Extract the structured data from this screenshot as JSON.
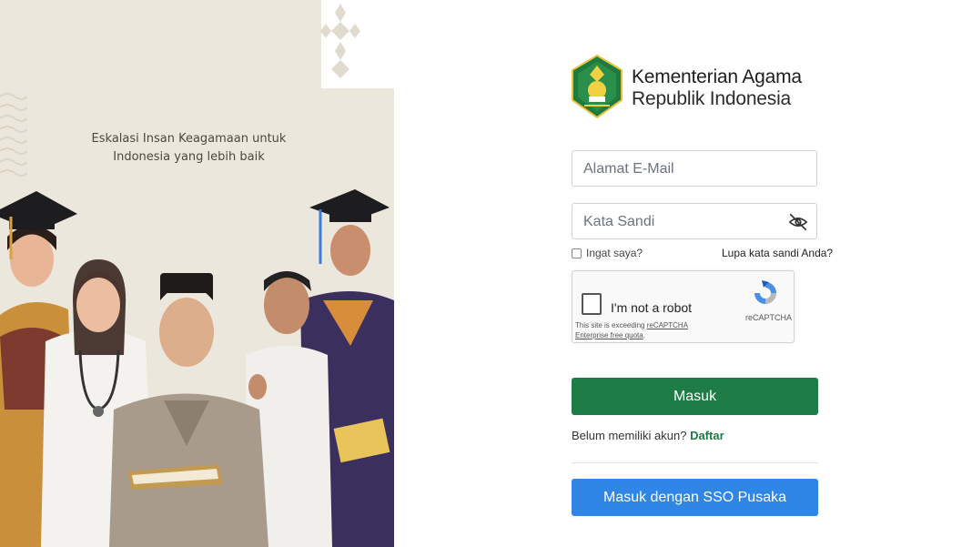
{
  "hero": {
    "tagline_line1": "Eskalasi Insan Keagamaan untuk",
    "tagline_line2": "Indonesia yang lebih baik",
    "background_color": "#ece7dc"
  },
  "brand": {
    "title": "Kementerian Agama",
    "subtitle": "Republik Indonesia",
    "logo_icon": "kemenag-emblem-icon"
  },
  "form": {
    "email_placeholder": "Alamat E-Mail",
    "email_value": "",
    "password_placeholder": "Kata Sandi",
    "password_value": "",
    "password_toggle_icon": "eye-off-icon",
    "remember_label": "Ingat saya?",
    "remember_checked": false,
    "forgot_label": "Lupa kata sandi Anda?"
  },
  "captcha": {
    "label": "I'm not a robot",
    "note_prefix": "This site is exceeding ",
    "note_link": "reCAPTCHA Enterprise free quota",
    "note_suffix": ".",
    "brand": "reCAPTCHA"
  },
  "actions": {
    "login_label": "Masuk",
    "register_prompt": "Belum memiliki akun?",
    "register_link": "Daftar",
    "sso_label": "Masuk dengan SSO Pusaka"
  },
  "colors": {
    "primary_green": "#1e7c46",
    "sso_blue": "#2f86e6"
  }
}
